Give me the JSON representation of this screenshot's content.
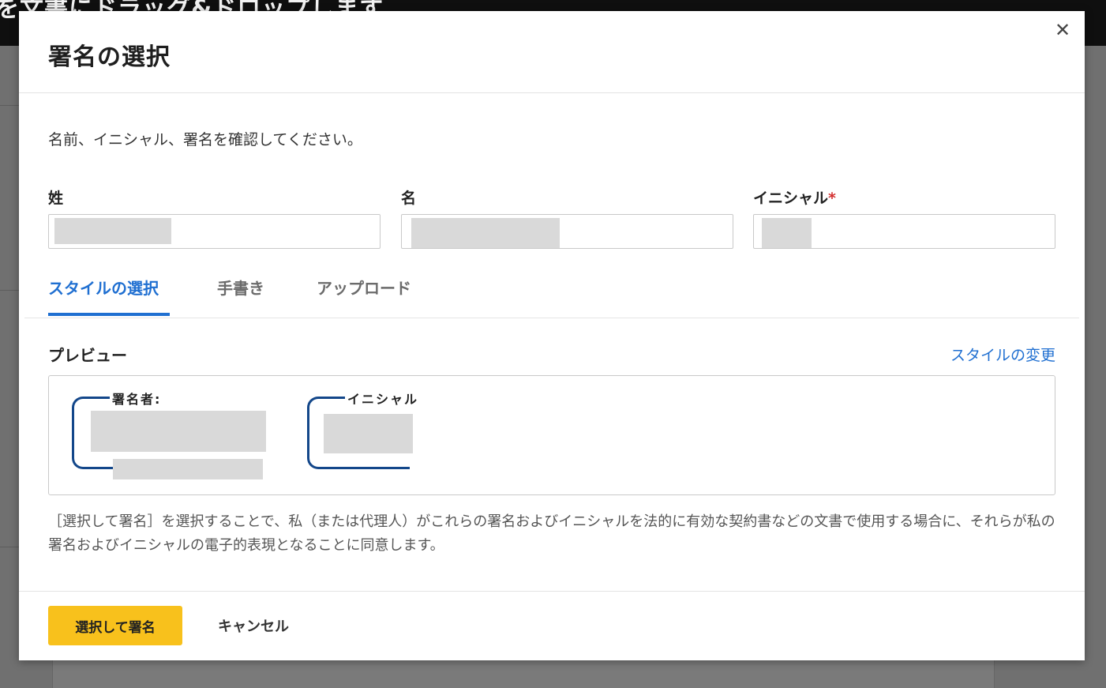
{
  "background": {
    "banner_text": "を文書にドラッグ&ドロップします"
  },
  "dialog": {
    "title": "署名の選択",
    "close_symbol": "✕",
    "instruction": "名前、イニシャル、署名を確認してください。",
    "fields": {
      "last_name_label": "姓",
      "first_name_label": "名",
      "initials_label": "イニシャル",
      "required_mark": "*"
    },
    "tabs": [
      {
        "label": "スタイルの選択",
        "active": true
      },
      {
        "label": "手書き",
        "active": false
      },
      {
        "label": "アップロード",
        "active": false
      }
    ],
    "preview": {
      "label": "プレビュー",
      "change_style_link": "スタイルの変更",
      "signature_caption": "署名者:",
      "initials_caption": "イニシャル"
    },
    "consent_text": "［選択して署名］を選択することで、私（または代理人）がこれらの署名およびイニシャルを法的に有効な契約書などの文書で使用する場合に、それらが私の署名およびイニシャルの電子的表現となることに同意します。",
    "footer": {
      "primary_label": "選択して署名",
      "cancel_label": "キャンセル"
    }
  },
  "colors": {
    "accent_blue": "#1f6fd1",
    "primary_button": "#f8c11c",
    "bracket_navy": "#13478a",
    "required_red": "#d32f2f"
  }
}
